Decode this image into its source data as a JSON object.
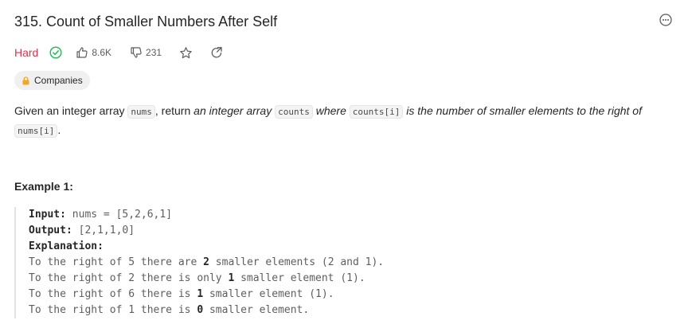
{
  "problem": {
    "title": "315. Count of Smaller Numbers After Self",
    "difficulty": "Hard",
    "likes": "8.6K",
    "dislikes": "231",
    "companies_label": "Companies"
  },
  "description": {
    "t1": "Given an integer array ",
    "c1": "nums",
    "t2": ", return ",
    "e1": "an integer array ",
    "c2": "counts",
    "e2": " where ",
    "c3": "counts[i]",
    "e3": " is the number of smaller elements to the right of ",
    "c4": "nums[i]",
    "t3": "."
  },
  "example": {
    "title": "Example 1:",
    "input_label": "Input:",
    "input_value": " nums = [5,2,6,1]",
    "output_label": "Output:",
    "output_value": " [2,1,1,0]",
    "explanation_label": "Explanation:",
    "lines": [
      {
        "pre": "To the right of 5 there are ",
        "num": "2",
        "post": " smaller elements (2 and 1)."
      },
      {
        "pre": "To the right of 2 there is only ",
        "num": "1",
        "post": " smaller element (1)."
      },
      {
        "pre": "To the right of 6 there is ",
        "num": "1",
        "post": " smaller element (1)."
      },
      {
        "pre": "To the right of 1 there is ",
        "num": "0",
        "post": " smaller element."
      }
    ]
  },
  "colors": {
    "hard": "#e0304c",
    "solved_check": "#2cbb5d"
  },
  "icons": {
    "solved": "check-circle-icon",
    "like": "thumbs-up-icon",
    "dislike": "thumbs-down-icon",
    "favorite": "star-icon",
    "share": "share-icon",
    "more": "more-options-icon",
    "lock": "lock-icon"
  }
}
